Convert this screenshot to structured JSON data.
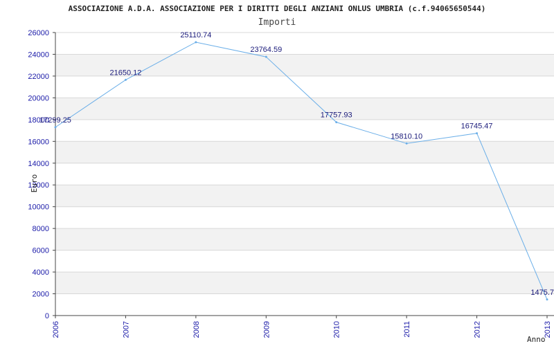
{
  "chart_data": {
    "type": "line",
    "title": "ASSOCIAZIONE A.D.A. ASSOCIAZIONE PER I DIRITTI DEGLI ANZIANI ONLUS UMBRIA (c.f.94065650544)",
    "subtitle": "Importi",
    "xlabel": "Anno",
    "ylabel": "Euro",
    "x": [
      "2006",
      "2007",
      "2008",
      "2009",
      "2010",
      "2011",
      "2012",
      "2013"
    ],
    "series": [
      {
        "values": [
          17299.25,
          21650.12,
          25110.74,
          23764.59,
          17757.93,
          15810.1,
          16745.47,
          1475.7
        ],
        "labels": [
          "17299.25",
          "21650.12",
          "25110.74",
          "23764.59",
          "17757.93",
          "15810.10",
          "16745.47",
          "1475.7"
        ]
      }
    ],
    "ylim": [
      0,
      26000
    ],
    "yticks": [
      "0",
      "2000",
      "4000",
      "6000",
      "8000",
      "10000",
      "12000",
      "14000",
      "16000",
      "18000",
      "20000",
      "22000",
      "24000",
      "26000"
    ],
    "grid": true,
    "line_color": "#6aaee8",
    "band_color": "#f2f2f2",
    "grid_color": "#d8d8d8",
    "tick_color": "#1a1aa8"
  }
}
